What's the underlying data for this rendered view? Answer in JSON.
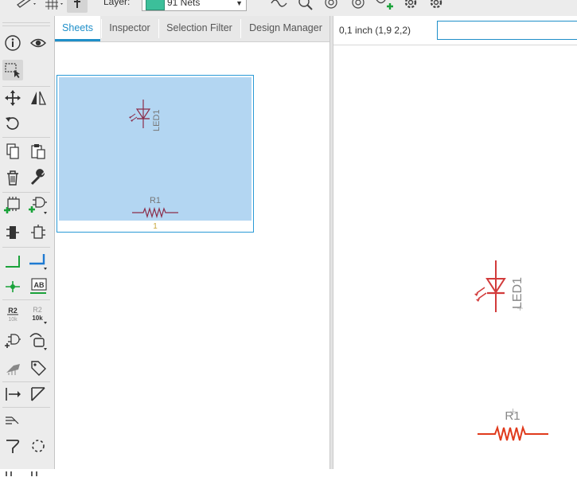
{
  "toolbar": {
    "layer_label": "Layer:",
    "layer_value": "91 Nets",
    "layer_color": "#3cbf9a"
  },
  "toolbox": {
    "tools": [
      "info-tool",
      "show-tool",
      "group-tool",
      "move-tool",
      "mirror-tool",
      "rotate-tool",
      "copy-tool",
      "paste-tool",
      "delete-tool",
      "change-tool",
      "add-part-tool",
      "replace-tool",
      "gate-swap-tool",
      "pin-swap-tool",
      "wire-tool",
      "net-tool",
      "junction-tool",
      "label-tool",
      "name-tool",
      "value-tool",
      "invoke-tool",
      "smash-tool",
      "miter-tool",
      "attribute-tool",
      "split-tool",
      "line-tool",
      "bus-tool",
      "ercheck-tool",
      "optimize-tool"
    ],
    "name_icon_text": "R2",
    "name_icon_sub": "10k",
    "value_icon_text": "R2",
    "value_icon_sub": "10k",
    "label_icon_text": "AB"
  },
  "panel": {
    "tabs": [
      {
        "label": "Sheets",
        "active": true
      },
      {
        "label": "Inspector",
        "active": false
      },
      {
        "label": "Selection Filter",
        "active": false
      },
      {
        "label": "Design Manager",
        "active": false
      }
    ],
    "sheet": {
      "number": "1",
      "parts": [
        {
          "name": "LED1",
          "type": "led"
        },
        {
          "name": "R1",
          "type": "resistor"
        }
      ]
    }
  },
  "canvas": {
    "grid_info": "0,1 inch (1,9 2,2)",
    "command_value": "",
    "parts": [
      {
        "name": "LED1",
        "type": "led",
        "color": "#d23b3b"
      },
      {
        "name": "R1",
        "type": "resistor",
        "color": "#e03a1c"
      }
    ]
  }
}
